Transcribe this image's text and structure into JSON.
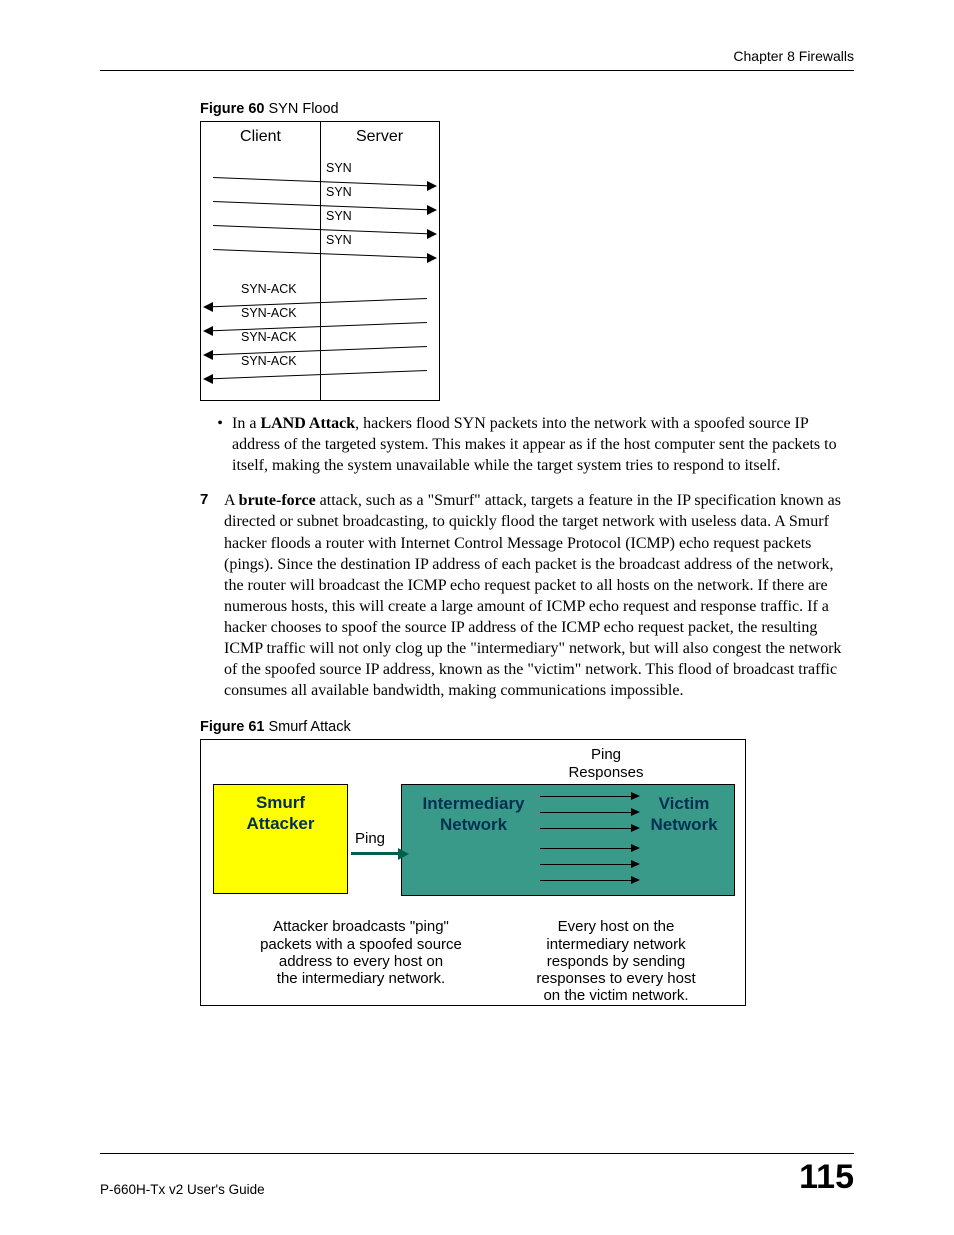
{
  "header": {
    "chapter": "Chapter 8 Firewalls"
  },
  "fig60": {
    "caption_bold": "Figure 60",
    "caption_rest": "   SYN Flood",
    "client": "Client",
    "server": "Server",
    "syn": "SYN",
    "synack": "SYN-ACK"
  },
  "body": {
    "bullet_pre": "In a ",
    "bullet_bold": "LAND Attack",
    "bullet_post": ", hackers flood SYN packets into the network with a spoofed source IP address of the targeted system. This makes it appear as if the host computer sent the packets to itself, making the system unavailable while the target system tries to respond to itself.",
    "num": "7",
    "num_pre": "A ",
    "num_bold": "brute-force",
    "num_post": " attack, such as a \"Smurf\" attack, targets a feature in the IP specification known as directed or subnet broadcasting, to quickly flood the target network with useless data. A Smurf hacker floods a router with Internet Control Message Protocol (ICMP) echo request packets (pings). Since the destination IP address of each packet is the broadcast address of the network, the router will broadcast the ICMP echo request packet to all hosts on the network. If there are numerous hosts, this will create a large amount of ICMP echo request and response traffic. If a hacker chooses to spoof the source IP address of the ICMP echo request packet, the resulting ICMP traffic will not only clog up the \"intermediary\" network, but will also congest the network of the spoofed source IP address, known as the \"victim\" network. This flood of broadcast traffic consumes all available bandwidth, making communications impossible."
  },
  "fig61": {
    "caption_bold": "Figure 61",
    "caption_rest": "   Smurf Attack",
    "top": "Ping\nResponses",
    "smurf": "Smurf\nAttacker",
    "inter": "Intermediary\nNetwork",
    "victim": "Victim\nNetwork",
    "ping": "Ping",
    "explain_left": "Attacker broadcasts \"ping\"\npackets with a spoofed source\naddress to every host on\nthe intermediary network.",
    "explain_right": "Every host on the\nintermediary network\nresponds by sending\nresponses to every host\non the victim network."
  },
  "footer": {
    "guide": "P-660H-Tx v2 User's Guide",
    "page": "115"
  }
}
